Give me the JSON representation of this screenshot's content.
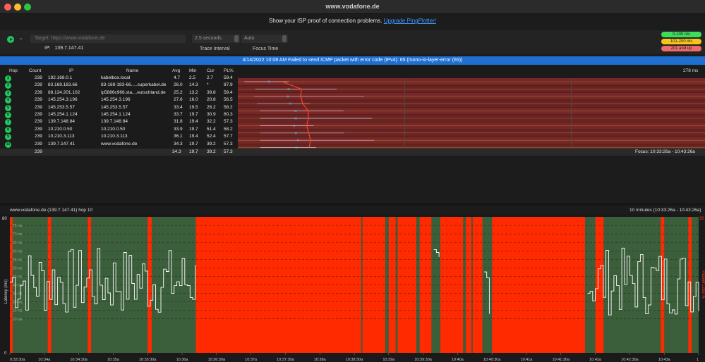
{
  "window": {
    "title": "www.vodafone.de"
  },
  "promo": {
    "text": "Show your ISP proof of connection problems.",
    "link": "Upgrade PingPlotter!"
  },
  "toolbar": {
    "target_placeholder": "Target:  https://www.vodafone.de",
    "ip_label": "IP:",
    "ip_value": "139.7.147.41",
    "interval_value": "2.5 seconds",
    "interval_label": "Trace Interval",
    "focus_value": "Auto",
    "focus_label": "Focus Time"
  },
  "legend": [
    {
      "label": "0-100 ms",
      "color": "#3ddc5c"
    },
    {
      "label": "101-200 ms",
      "color": "#f5c518"
    },
    {
      "label": "201 and up",
      "color": "#ef6a6a"
    }
  ],
  "error_bar": {
    "text": "4/14/2022 10:08 AM Failed to send ICMP packet with error code (IPv4): 65 (mono-io-layer-error (65))"
  },
  "table": {
    "headers": {
      "hop": "Hop",
      "count": "Count",
      "ip": "IP",
      "name": "Name",
      "avg": "Avg",
      "min": "Min",
      "cur": "Cur",
      "pl": "PL%",
      "scale": "278 ms"
    },
    "rows": [
      {
        "hop": "1",
        "count": "239",
        "ip": "192.168.0.1",
        "name": "kabelbox.local",
        "avg": "4.7",
        "min": "2.5",
        "cur": "2.7",
        "pl": "59.4"
      },
      {
        "hop": "2",
        "count": "239",
        "ip": "83.169.183.66",
        "name": "83-169-183-66.....superkabel.de",
        "avg": "26.0",
        "min": "14.3",
        "cur": "*",
        "pl": "87.9"
      },
      {
        "hop": "3",
        "count": "239",
        "ip": "88.134.201.102",
        "name": "ip5886c966.sta....eutschland.de",
        "avg": "25.2",
        "min": "13.2",
        "cur": "39.8",
        "pl": "59.4"
      },
      {
        "hop": "4",
        "count": "239",
        "ip": "145.254.3.196",
        "name": "145.254.3.196",
        "avg": "27.6",
        "min": "16.0",
        "cur": "20.8",
        "pl": "56.5"
      },
      {
        "hop": "5",
        "count": "239",
        "ip": "145.253.5.57",
        "name": "145.253.5.57",
        "avg": "33.4",
        "min": "19.5",
        "cur": "26.2",
        "pl": "58.2"
      },
      {
        "hop": "6",
        "count": "239",
        "ip": "145.254.1.124",
        "name": "145.254.1.124",
        "avg": "33.7",
        "min": "19.7",
        "cur": "30.9",
        "pl": "60.3"
      },
      {
        "hop": "7",
        "count": "239",
        "ip": "139.7.148.84",
        "name": "139.7.148.84",
        "avg": "31.8",
        "min": "19.4",
        "cur": "32.2",
        "pl": "57.3"
      },
      {
        "hop": "8",
        "count": "239",
        "ip": "10.210.0.50",
        "name": "10.210.0.50",
        "avg": "33.9",
        "min": "19.7",
        "cur": "51.4",
        "pl": "58.2"
      },
      {
        "hop": "9",
        "count": "239",
        "ip": "10.210.3.113",
        "name": "10.210.3.113",
        "avg": "36.1",
        "min": "19.4",
        "cur": "52.4",
        "pl": "57.7"
      },
      {
        "hop": "10",
        "count": "239",
        "ip": "139.7.147.41",
        "name": "www.vodafone.de",
        "avg": "34.3",
        "min": "19.7",
        "cur": "39.2",
        "pl": "57.3"
      }
    ],
    "summary": {
      "count": "239",
      "avg": "34.3",
      "min": "19.7",
      "cur": "39.2",
      "pl": "57.3",
      "focus": "Focus: 10:33:26a - 10:43:26a"
    }
  },
  "graph": {
    "title": "www.vodafone.de (139.7.147.41) hop 10",
    "range": "10 minutes (10:33:26a - 10:43:26a)",
    "ylabel": "Latency (ms)",
    "ylabel_right": "Packet Loss %",
    "y_max": "80",
    "y_min": "0",
    "y_right_max": "30",
    "ms_ticks": [
      "75 ms",
      "70 ms",
      "65 ms",
      "60 ms",
      "55 ms",
      "50 ms",
      "45 ms",
      "40 ms",
      "35 ms",
      "30 ms",
      "25 ms",
      "20 ms"
    ],
    "x_ticks": [
      "0:33:30a",
      "10:34a",
      "10:34:30a",
      "10:35a",
      "10:35:30a",
      "10:36a",
      "10:36:30a",
      "10:37a",
      "10:37:30a",
      "10:38a",
      "10:38:30a",
      "10:39a",
      "10:39:30a",
      "10:40a",
      "10:40:30a",
      "10:41a",
      "10:41:30a",
      "10:42a",
      "10:42:30a",
      "10:43a",
      "1"
    ]
  },
  "colors": {
    "accent": "#1f6fd1",
    "loss": "#ff2a00",
    "good": "#3b5e3b",
    "line": "#ffffff"
  }
}
